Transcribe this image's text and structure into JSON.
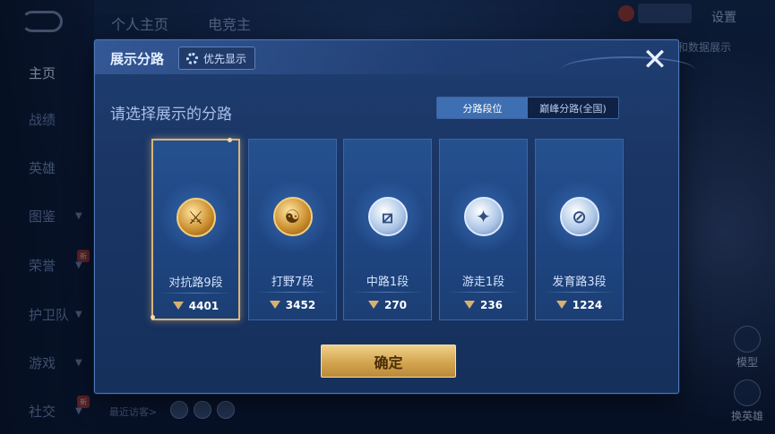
{
  "background": {
    "top_tabs": [
      "个人主页",
      "电竞主"
    ],
    "settings_label": "设置",
    "right_hint": "和数据展示",
    "sidebar": [
      {
        "label": "主页",
        "active": true
      },
      {
        "label": "战绩"
      },
      {
        "label": "英雄"
      },
      {
        "label": "图鉴",
        "chevron": true
      },
      {
        "label": "荣誉",
        "chevron": true,
        "badge": "新"
      },
      {
        "label": "护卫队",
        "chevron": true
      },
      {
        "label": "游戏",
        "chevron": true
      },
      {
        "label": "社交",
        "chevron": true,
        "badge": "新"
      }
    ],
    "recent_visitors_label": "最近访客>",
    "right_buttons": [
      "模型",
      "换英雄"
    ]
  },
  "modal": {
    "title": "展示分路",
    "priority_label": "优先显示",
    "close_icon": "close-icon",
    "subtitle": "请选择展示的分路",
    "segments": [
      "分路段位",
      "巅峰分路(全国)"
    ],
    "active_segment": 0,
    "cards": [
      {
        "label": "对抗路9段",
        "score": "4401",
        "emblem": "gold",
        "glyph": "⚔",
        "selected": true
      },
      {
        "label": "打野7段",
        "score": "3452",
        "emblem": "gold",
        "glyph": "☯",
        "selected": false
      },
      {
        "label": "中路1段",
        "score": "270",
        "emblem": "silver",
        "glyph": "⧄",
        "selected": false
      },
      {
        "label": "游走1段",
        "score": "236",
        "emblem": "silver",
        "glyph": "✦",
        "selected": false
      },
      {
        "label": "发育路3段",
        "score": "1224",
        "emblem": "silver",
        "glyph": "⊘",
        "selected": false
      }
    ],
    "confirm_label": "确定"
  },
  "colors": {
    "accent_gold": "#d9b37a",
    "panel_blue": "#1a3564",
    "segment_active": "#3e6fb3"
  }
}
